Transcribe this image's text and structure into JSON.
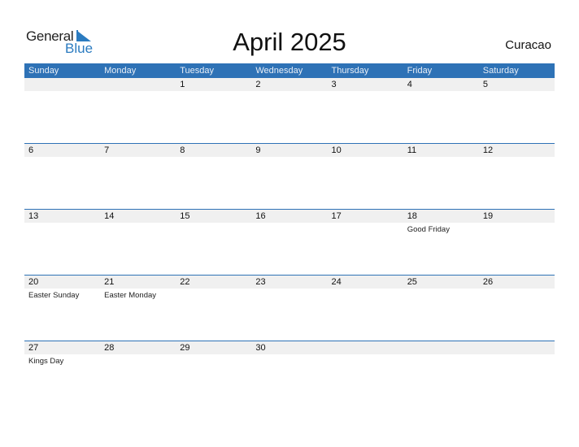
{
  "logo": {
    "text1": "General",
    "text2": "Blue"
  },
  "title": "April 2025",
  "country": "Curacao",
  "weekdays": [
    "Sunday",
    "Monday",
    "Tuesday",
    "Wednesday",
    "Thursday",
    "Friday",
    "Saturday"
  ],
  "weeks": [
    [
      {
        "d": ""
      },
      {
        "d": ""
      },
      {
        "d": "1"
      },
      {
        "d": "2"
      },
      {
        "d": "3"
      },
      {
        "d": "4"
      },
      {
        "d": "5"
      }
    ],
    [
      {
        "d": "6"
      },
      {
        "d": "7"
      },
      {
        "d": "8"
      },
      {
        "d": "9"
      },
      {
        "d": "10"
      },
      {
        "d": "11"
      },
      {
        "d": "12"
      }
    ],
    [
      {
        "d": "13"
      },
      {
        "d": "14"
      },
      {
        "d": "15"
      },
      {
        "d": "16"
      },
      {
        "d": "17"
      },
      {
        "d": "18",
        "h": "Good Friday"
      },
      {
        "d": "19"
      }
    ],
    [
      {
        "d": "20",
        "h": "Easter Sunday"
      },
      {
        "d": "21",
        "h": "Easter Monday"
      },
      {
        "d": "22"
      },
      {
        "d": "23"
      },
      {
        "d": "24"
      },
      {
        "d": "25"
      },
      {
        "d": "26"
      }
    ],
    [
      {
        "d": "27",
        "h": "Kings Day"
      },
      {
        "d": "28"
      },
      {
        "d": "29"
      },
      {
        "d": "30"
      },
      {
        "d": ""
      },
      {
        "d": ""
      },
      {
        "d": ""
      }
    ]
  ]
}
